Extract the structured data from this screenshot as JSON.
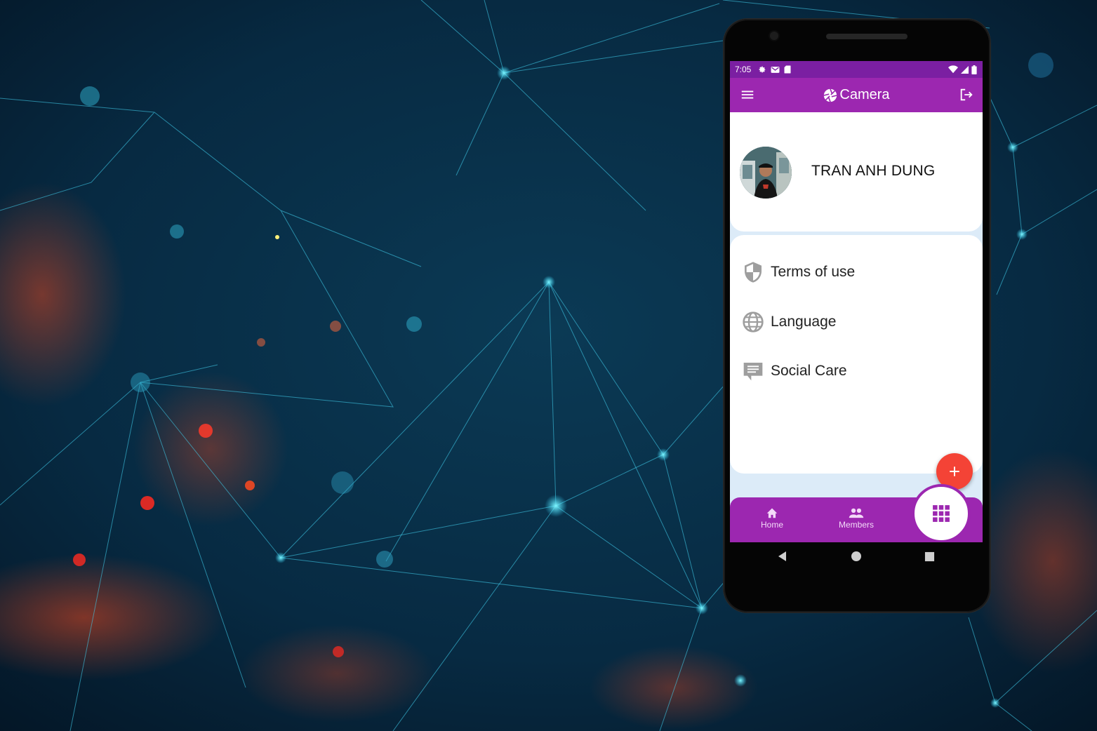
{
  "status_bar": {
    "time": "7:05"
  },
  "app_bar": {
    "title": "Camera",
    "accent": "#9c27b0",
    "status_color": "#7b1fa2"
  },
  "profile": {
    "name": "TRAN ANH DUNG"
  },
  "menu": {
    "items": [
      {
        "label": "Terms of use",
        "icon": "shield-icon"
      },
      {
        "label": "Language",
        "icon": "globe-icon"
      },
      {
        "label": "Social Care",
        "icon": "chat-icon"
      }
    ]
  },
  "fab": {
    "symbol": "+",
    "color": "#f44336"
  },
  "bottom_nav": {
    "items": [
      {
        "label": "Home",
        "icon": "home-icon"
      },
      {
        "label": "Members",
        "icon": "members-icon"
      }
    ],
    "center_icon": "grid-icon"
  }
}
